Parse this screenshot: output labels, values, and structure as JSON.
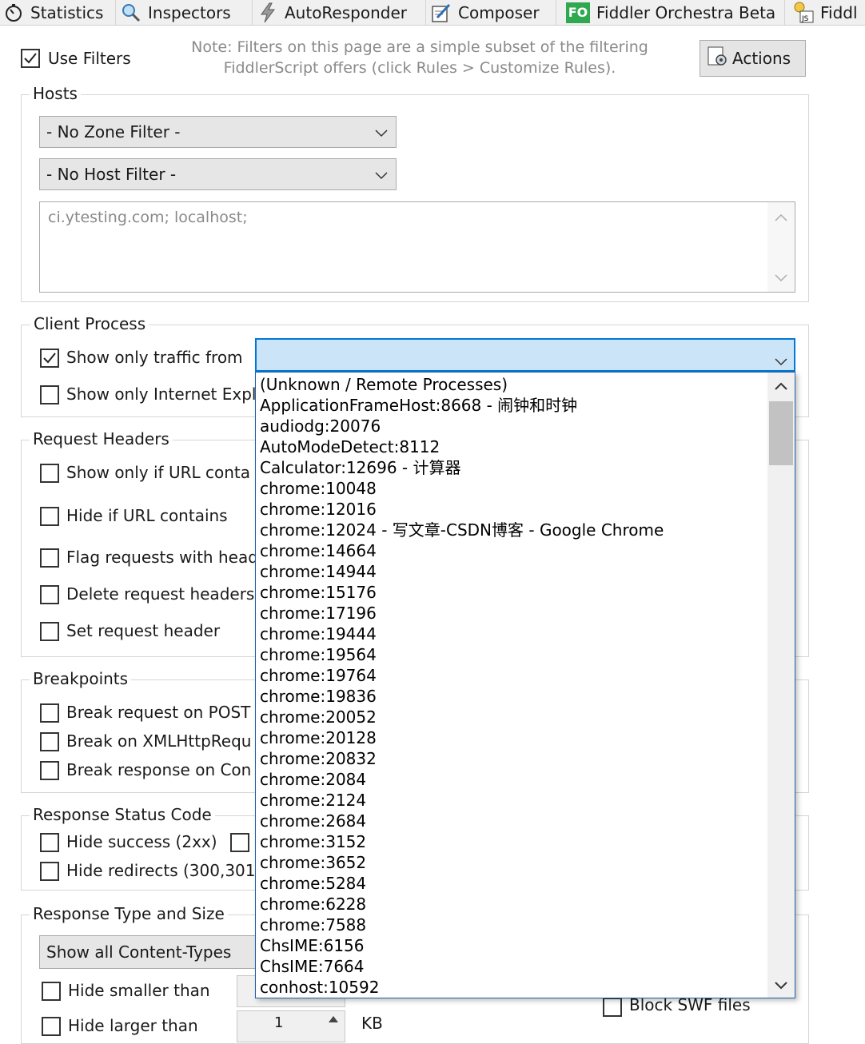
{
  "tabs": [
    {
      "label": "Statistics",
      "icon": "stopwatch-icon"
    },
    {
      "label": "Inspectors",
      "icon": "magnifier-icon"
    },
    {
      "label": "AutoResponder",
      "icon": "lightning-icon"
    },
    {
      "label": "Composer",
      "icon": "composer-edit-icon"
    },
    {
      "label": "Fiddler Orchestra Beta",
      "icon": "fiddler-orchestra-icon",
      "badge": "FO"
    },
    {
      "label": "Fiddl",
      "icon": "fiddlerscript-icon",
      "badge": "JS"
    }
  ],
  "filters": {
    "use_filters_label": "Use Filters",
    "use_filters_checked": true,
    "note": "Note: Filters on this page are a simple subset of the filtering FiddlerScript offers (click Rules > Customize Rules).",
    "actions_label": "Actions"
  },
  "hosts": {
    "legend": "Hosts",
    "zone_filter": "- No Zone Filter -",
    "host_filter": "- No Host Filter -",
    "host_list": "ci.ytesting.com; localhost;"
  },
  "client_process": {
    "legend": "Client Process",
    "show_only_traffic_from_label": "Show only traffic from",
    "show_only_traffic_from_checked": true,
    "show_only_ie_label": "Show only Internet Expl",
    "show_only_ie_checked": false,
    "dropdown_value": "",
    "dropdown_options": [
      "(Unknown / Remote Processes)",
      "ApplicationFrameHost:8668 - 闹钟和时钟",
      "audiodg:20076",
      "AutoModeDetect:8112",
      "Calculator:12696 - 计算器",
      "chrome:10048",
      "chrome:12016",
      "chrome:12024 - 写文章-CSDN博客 - Google Chrome",
      "chrome:14664",
      "chrome:14944",
      "chrome:15176",
      "chrome:17196",
      "chrome:19444",
      "chrome:19564",
      "chrome:19764",
      "chrome:19836",
      "chrome:20052",
      "chrome:20128",
      "chrome:20832",
      "chrome:2084",
      "chrome:2124",
      "chrome:2684",
      "chrome:3152",
      "chrome:3652",
      "chrome:5284",
      "chrome:6228",
      "chrome:7588",
      "ChsIME:6156",
      "ChsIME:7664",
      "conhost:10592"
    ]
  },
  "request_headers": {
    "legend": "Request Headers",
    "show_only_url_label": "Show only if URL conta",
    "hide_url_label": "Hide if URL contains",
    "flag_requests_label": "Flag requests with head",
    "delete_headers_label": "Delete request headers",
    "set_header_label": "Set request header"
  },
  "breakpoints": {
    "legend": "Breakpoints",
    "break_post_label": "Break request on POST",
    "break_xhr_label": "Break on XMLHttpRequ",
    "break_response_label": "Break response on Con"
  },
  "response_status": {
    "legend": "Response Status Code",
    "hide_success_label": "Hide success (2xx)",
    "hide_redirects_label": "Hide redirects (300,301"
  },
  "response_type": {
    "legend": "Response Type and Size",
    "content_types": "Show all Content-Types",
    "hide_smaller_label": "Hide smaller than",
    "hide_larger_label": "Hide larger than",
    "larger_value": "1",
    "kb_label": "KB",
    "block_swf_label": "Block SWF files"
  },
  "colors": {
    "dropdown_highlight": "#cce4f7",
    "dropdown_border": "#0078d7",
    "fo_badge": "#2fa84f"
  }
}
